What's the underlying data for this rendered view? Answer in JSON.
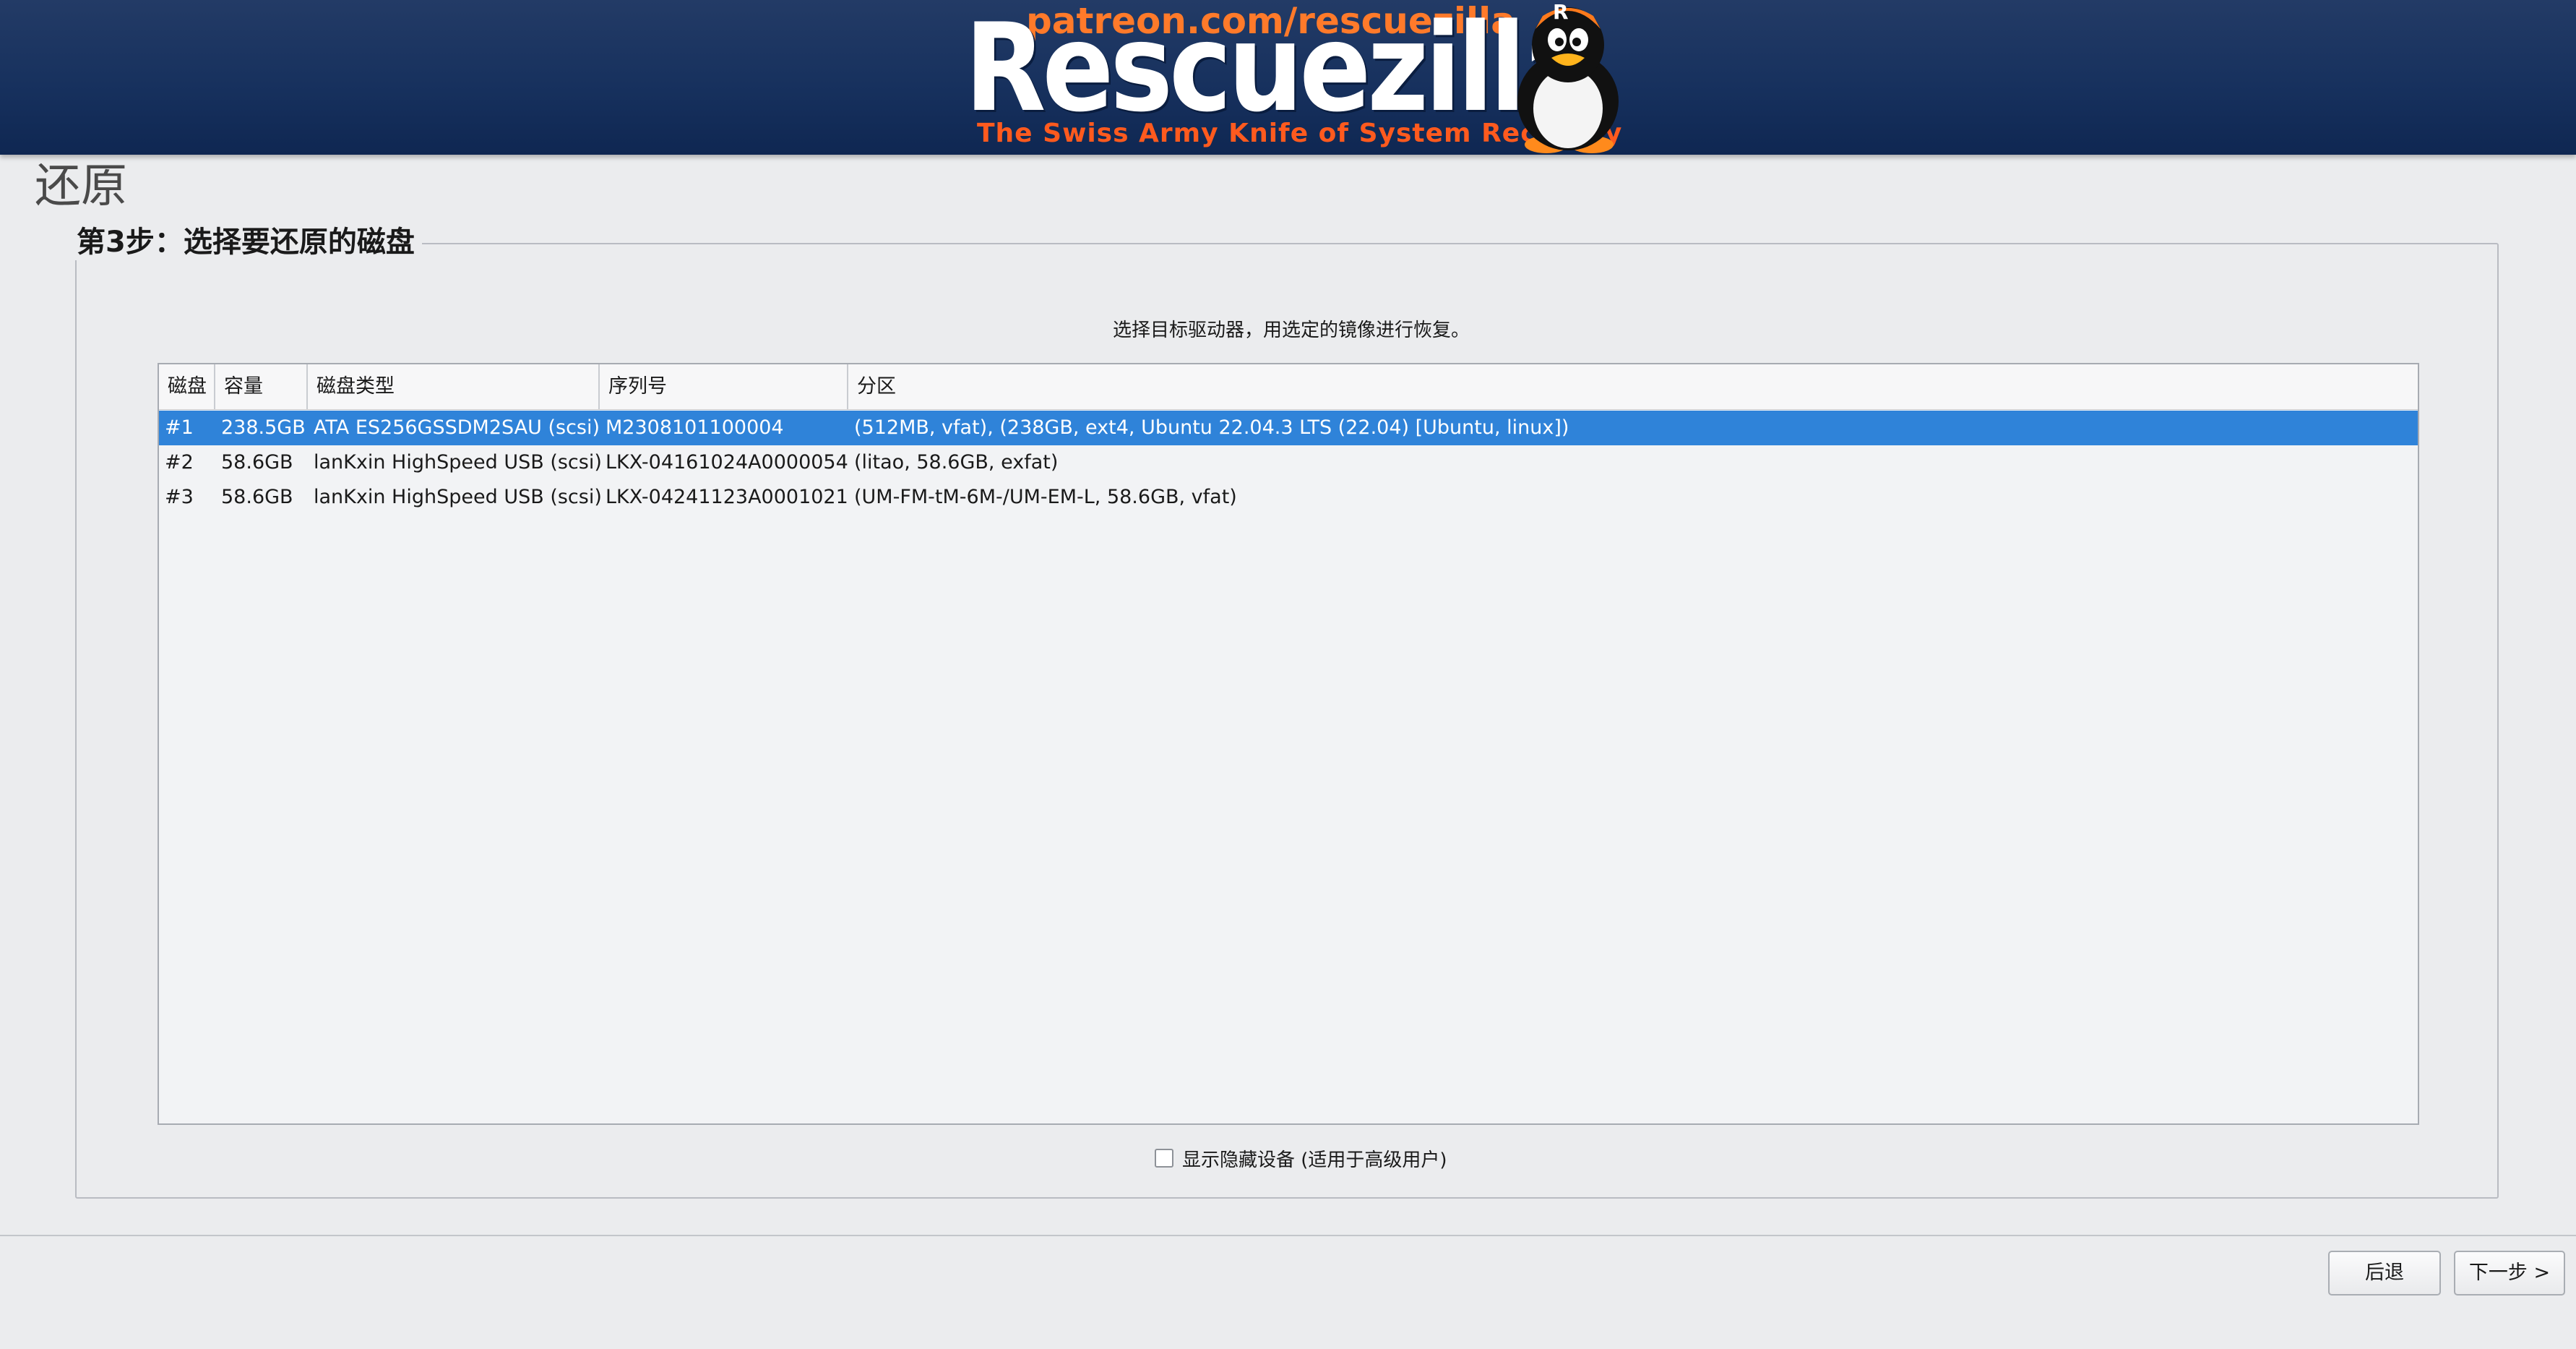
{
  "banner": {
    "url_text": "patreon.com/rescuezilla",
    "app_name": "Rescuezilla",
    "tagline": "The Swiss Army Knife of System Recovery",
    "mascot": "penguin-mascot-icon",
    "mascot_badge": "R",
    "colors": {
      "background": "#17315e",
      "accent": "#ff6a20"
    }
  },
  "page": {
    "title": "还原",
    "step_title": "第3步：选择要还原的磁盘",
    "instruction": "选择目标驱动器，用选定的镜像进行恢复。"
  },
  "table": {
    "columns": [
      "磁盘",
      "容量",
      "磁盘类型",
      "序列号",
      "分区"
    ],
    "selected_index": 0,
    "selection_color": "#2f83d9",
    "rows": [
      {
        "disk": "#1",
        "capacity": "238.5GB",
        "type": "ATA ES256GSSDM2SAU (scsi)",
        "serial": "M2308101100004",
        "partitions": "(512MB, vfat), (238GB, ext4, Ubuntu 22.04.3 LTS (22.04) [Ubuntu, linux])"
      },
      {
        "disk": "#2",
        "capacity": "58.6GB",
        "type": "lanKxin HighSpeed USB (scsi)",
        "serial": "LKX-04161024A0000054",
        "partitions": "(litao, 58.6GB, exfat)"
      },
      {
        "disk": "#3",
        "capacity": "58.6GB",
        "type": "lanKxin HighSpeed USB (scsi)",
        "serial": "LKX-04241123A0001021",
        "partitions": "(UM-FM-tM-6M-/UM-EM-L, 58.6GB, vfat)"
      }
    ]
  },
  "options": {
    "show_hidden_label": "显示隐藏设备 (适用于高级用户)",
    "show_hidden_checked": false
  },
  "footer": {
    "back_label": "后退",
    "next_label": "下一步 >"
  }
}
